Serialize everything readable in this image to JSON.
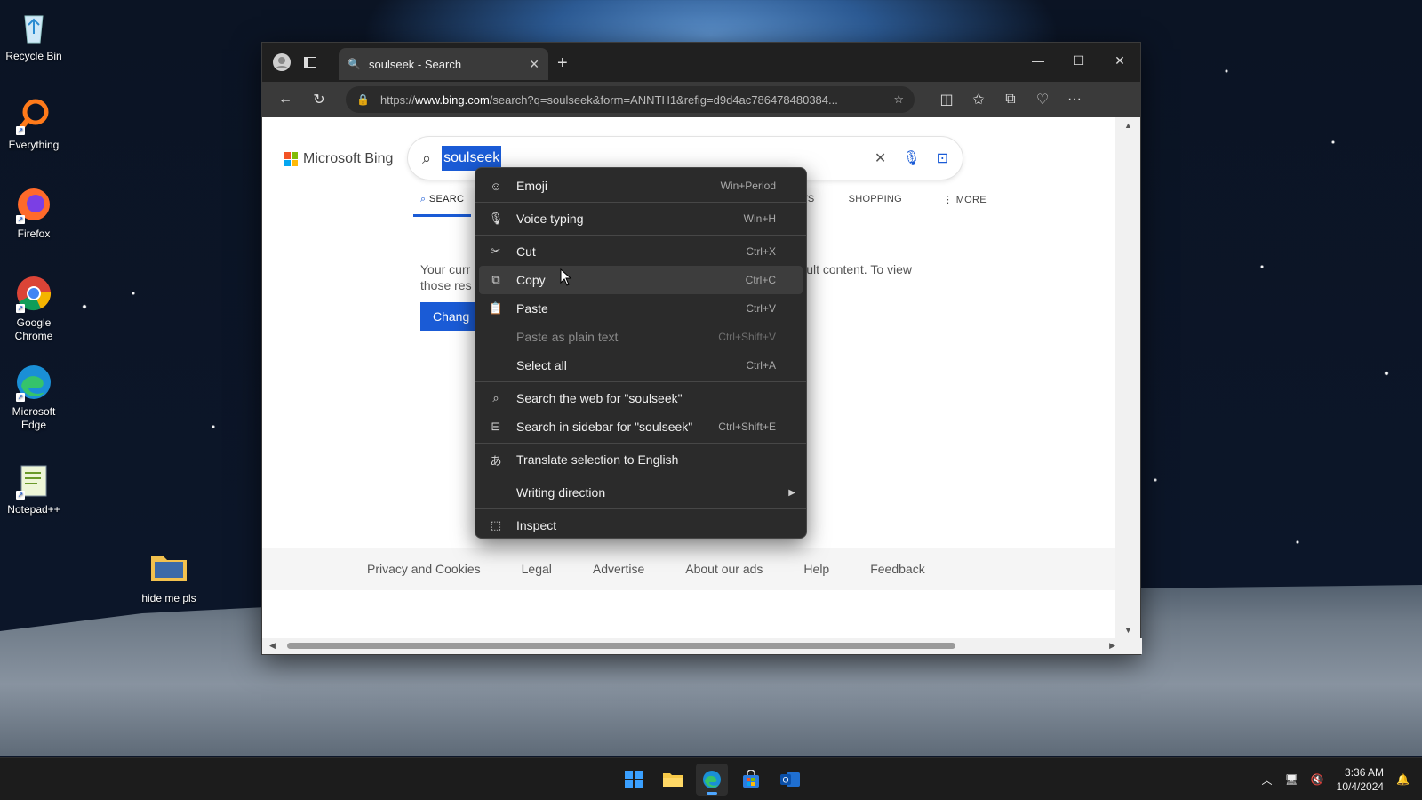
{
  "desktop": {
    "icons": [
      {
        "label": "Recycle Bin"
      },
      {
        "label": "Everything"
      },
      {
        "label": "Firefox"
      },
      {
        "label": "Google Chrome"
      },
      {
        "label": "Microsoft Edge"
      },
      {
        "label": "Notepad++"
      },
      {
        "label": "hide me pls"
      }
    ]
  },
  "browser": {
    "tab_title": "soulseek - Search",
    "url_prefix": "https://",
    "url_host": "www.bing.com",
    "url_rest": "/search?q=soulseek&form=ANNTH1&refig=d9d4ac786478480384..."
  },
  "bing": {
    "logo_text": "Microsoft Bing",
    "query": "soulseek",
    "tabs": [
      "SEARC",
      "WS",
      "SHOPPING",
      "MORE"
    ],
    "notice_left": "Your curr",
    "notice_left2": "those res",
    "notice_right": "rn adult content. To view",
    "change_button": "Chang",
    "footer_links": [
      "Privacy and Cookies",
      "Legal",
      "Advertise",
      "About our ads",
      "Help",
      "Feedback"
    ]
  },
  "context_menu": {
    "items": [
      {
        "label": "Emoji",
        "shortcut": "Win+Period",
        "icon": "emoji-icon"
      },
      {
        "label": "Voice typing",
        "shortcut": "Win+H",
        "icon": "mic-icon"
      },
      {
        "label": "Cut",
        "shortcut": "Ctrl+X",
        "icon": "scissors-icon"
      },
      {
        "label": "Copy",
        "shortcut": "Ctrl+C",
        "icon": "copy-icon"
      },
      {
        "label": "Paste",
        "shortcut": "Ctrl+V",
        "icon": "paste-icon"
      },
      {
        "label": "Paste as plain text",
        "shortcut": "Ctrl+Shift+V",
        "icon": ""
      },
      {
        "label": "Select all",
        "shortcut": "Ctrl+A",
        "icon": ""
      },
      {
        "label": "Search the web for \"soulseek\"",
        "shortcut": "",
        "icon": "search-icon"
      },
      {
        "label": "Search in sidebar for \"soulseek\"",
        "shortcut": "Ctrl+Shift+E",
        "icon": "sidebar-search-icon"
      },
      {
        "label": "Translate selection to English",
        "shortcut": "",
        "icon": "translate-icon"
      },
      {
        "label": "Writing direction",
        "shortcut": "",
        "icon": ""
      },
      {
        "label": "Inspect",
        "shortcut": "",
        "icon": "inspect-icon"
      }
    ]
  },
  "taskbar": {
    "time": "3:36 AM",
    "date": "10/4/2024"
  }
}
